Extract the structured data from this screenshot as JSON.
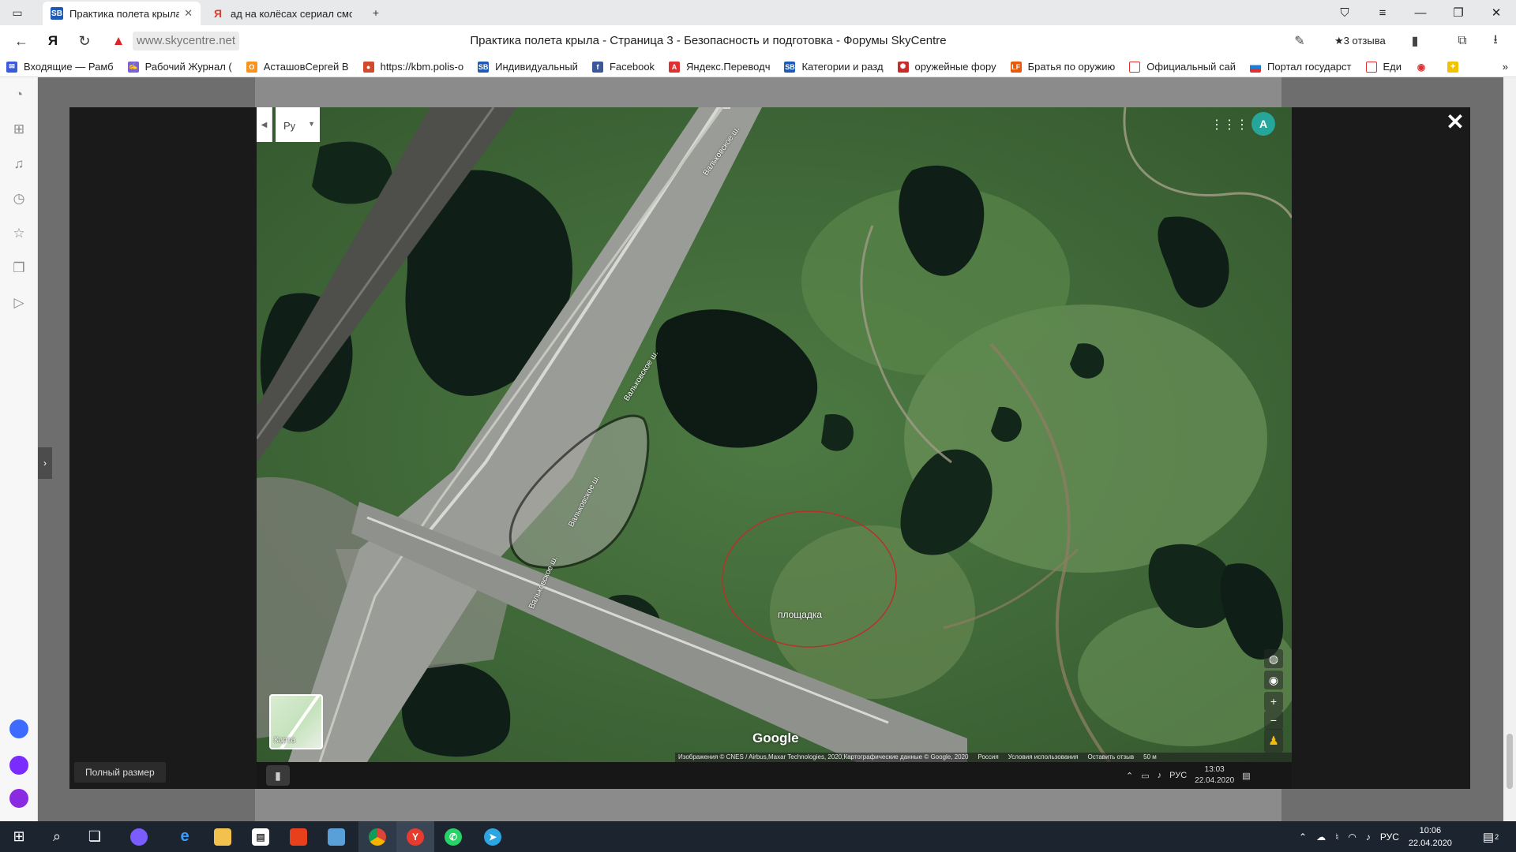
{
  "tabs": [
    {
      "title": "Практика полета крыла",
      "favicon": "SB",
      "favicon_color": "#1f5bb5",
      "active": true
    },
    {
      "title": "ад на колёсах сериал смот",
      "favicon": "Я",
      "favicon_color": "#e6372b",
      "active": false
    }
  ],
  "addressbar": {
    "domain": "www.skycentre.net",
    "page_title": "Практика полета крыла - Страница 3 - Безопасность и подготовка - Форумы SkyCentre",
    "reviews_label": "★3 отзыва"
  },
  "bookmarks": [
    {
      "label": "Входящие — Рамб",
      "icon": "mail-icon",
      "color": "#3b5bdb"
    },
    {
      "label": "Рабочий Журнал (",
      "icon": "journal-icon",
      "color": "#7b61d1"
    },
    {
      "label": "АсташовСергей В",
      "icon": "ok-icon",
      "color": "#f7931e"
    },
    {
      "label": "https://kbm.polis-o",
      "icon": "globe-icon",
      "color": "#d04a2c"
    },
    {
      "label": "Индивидуальный",
      "icon": "sb-icon",
      "color": "#1f5bb5"
    },
    {
      "label": "Facebook",
      "icon": "facebook-icon",
      "color": "#3b5998"
    },
    {
      "label": "Яндекс.Переводч",
      "icon": "translate-icon",
      "color": "#e03131"
    },
    {
      "label": "Категории и разд",
      "icon": "sb-icon",
      "color": "#1f5bb5"
    },
    {
      "label": "оружейные фору",
      "icon": "forum-icon",
      "color": "#c92a2a"
    },
    {
      "label": "Братья по оружию",
      "icon": "lf-icon",
      "color": "#e8590c"
    },
    {
      "label": "Официальный сай",
      "icon": "site-icon",
      "color": "#e03131"
    },
    {
      "label": "Портал государст",
      "icon": "flag-icon",
      "color": "#1c7ed6"
    },
    {
      "label": "Еди",
      "icon": "site-icon",
      "color": "#e03131"
    }
  ],
  "lightbox": {
    "close_label": "✕",
    "fullsize_label": "Полный размер"
  },
  "map": {
    "lang_label": "Ру",
    "avatar_letter": "A",
    "avatar_color": "#26a69a",
    "thumbnail_label": "Карта",
    "google_label": "Google",
    "place_label": "площадка",
    "road_labels": [
      "Вальковское ш.",
      "Вальковское ш.",
      "Вальковское ш.",
      "Вальковское ш."
    ],
    "attribution": [
      "Изображения © CNES / Airbus,Maxar Technologies, 2020,Картографические данные © Google, 2020",
      "Россия",
      "Условия использования",
      "Оставить отзыв",
      "50 м"
    ]
  },
  "screenshot_taskbar": {
    "lang": "РУС",
    "time": "13:03",
    "date": "22.04.2020"
  },
  "taskbar": {
    "lang": "РУС",
    "time": "10:06",
    "date": "22.04.2020",
    "notify_count": "2"
  }
}
